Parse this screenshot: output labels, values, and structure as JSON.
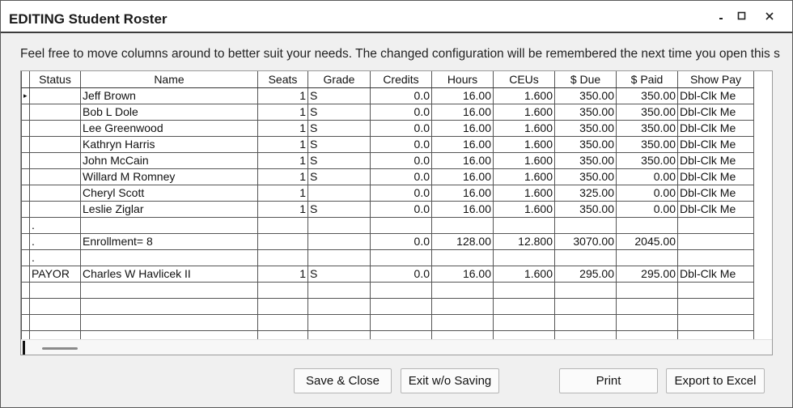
{
  "window": {
    "title": "EDITING Student Roster",
    "controls": [
      "minimize-icon",
      "maximize-icon",
      "close-icon"
    ]
  },
  "info_text": "Feel free to move columns around to better suit your needs. The changed configuration will be remembered the next time you open this s",
  "grid": {
    "columns": [
      "Status",
      "Name",
      "Seats",
      "Grade",
      "Credits",
      "Hours",
      "CEUs",
      "$ Due",
      "$ Paid",
      "Show Pay"
    ],
    "rows": [
      [
        "",
        "Jeff Brown",
        "1",
        "S",
        "0.0",
        "16.00",
        "1.600",
        "350.00",
        "350.00",
        "Dbl-Clk Me"
      ],
      [
        "",
        "Bob L Dole",
        "1",
        "S",
        "0.0",
        "16.00",
        "1.600",
        "350.00",
        "350.00",
        "Dbl-Clk Me"
      ],
      [
        "",
        "Lee Greenwood",
        "1",
        "S",
        "0.0",
        "16.00",
        "1.600",
        "350.00",
        "350.00",
        "Dbl-Clk Me"
      ],
      [
        "",
        "Kathryn Harris",
        "1",
        "S",
        "0.0",
        "16.00",
        "1.600",
        "350.00",
        "350.00",
        "Dbl-Clk Me"
      ],
      [
        "",
        "John McCain",
        "1",
        "S",
        "0.0",
        "16.00",
        "1.600",
        "350.00",
        "350.00",
        "Dbl-Clk Me"
      ],
      [
        "",
        "Willard M Romney",
        "1",
        "S",
        "0.0",
        "16.00",
        "1.600",
        "350.00",
        "0.00",
        "Dbl-Clk Me"
      ],
      [
        "",
        "Cheryl Scott",
        "1",
        "",
        "0.0",
        "16.00",
        "1.600",
        "325.00",
        "0.00",
        "Dbl-Clk Me"
      ],
      [
        "",
        "Leslie Ziglar",
        "1",
        "S",
        "0.0",
        "16.00",
        "1.600",
        "350.00",
        "0.00",
        "Dbl-Clk Me"
      ],
      [
        ".",
        "",
        "",
        "",
        "",
        "",
        "",
        "",
        "",
        ""
      ],
      [
        ".",
        "Enrollment=    8",
        "",
        "",
        "0.0",
        "128.00",
        "12.800",
        "3070.00",
        "2045.00",
        ""
      ],
      [
        ".",
        "",
        "",
        "",
        "",
        "",
        "",
        "",
        "",
        ""
      ],
      [
        "PAYOR",
        "Charles W Havlicek II",
        "1",
        "S",
        "0.0",
        "16.00",
        "1.600",
        "295.00",
        "295.00",
        "Dbl-Clk Me"
      ],
      [
        "",
        "",
        "",
        "",
        "",
        "",
        "",
        "",
        "",
        ""
      ],
      [
        "",
        "",
        "",
        "",
        "",
        "",
        "",
        "",
        "",
        ""
      ],
      [
        "",
        "",
        "",
        "",
        "",
        "",
        "",
        "",
        "",
        ""
      ],
      [
        "",
        "",
        "",
        "",
        "",
        "",
        "",
        "",
        "",
        ""
      ]
    ],
    "current_row_indicator": "▸",
    "selection_color": "#1e6fd9"
  },
  "buttons": {
    "save_close": "Save & Close",
    "exit_without_saving": "Exit w/o Saving",
    "print": "Print",
    "export_excel": "Export to Excel"
  }
}
